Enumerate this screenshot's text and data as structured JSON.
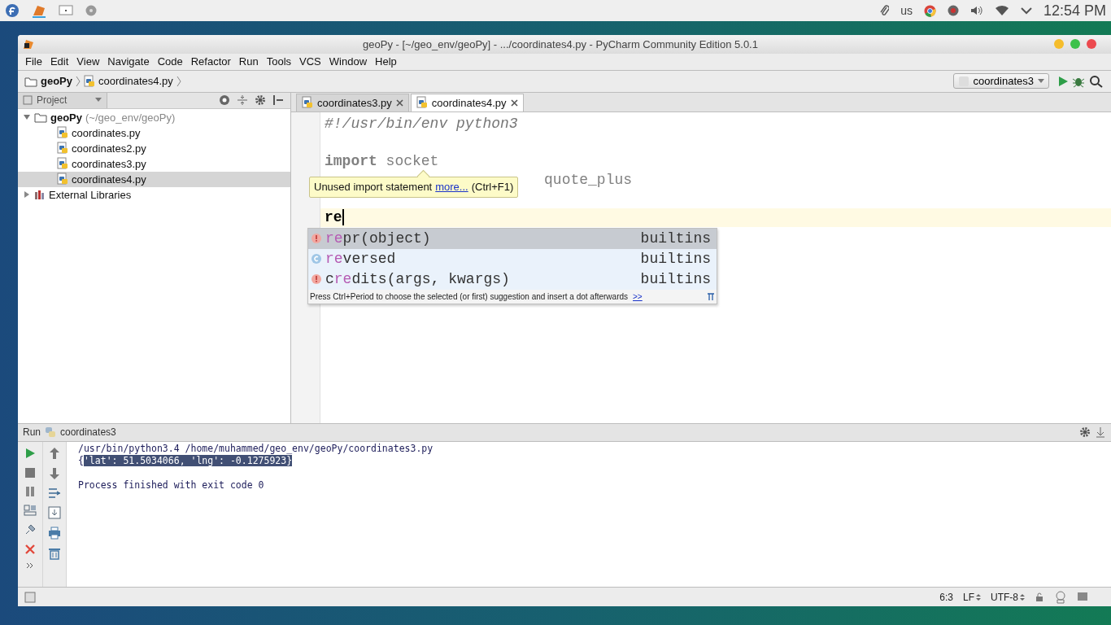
{
  "top_panel": {
    "keyboard_layout": "us",
    "clock": "12:54 PM"
  },
  "window": {
    "title": "geoPy - [~/geo_env/geoPy] - .../coordinates4.py - PyCharm Community Edition 5.0.1"
  },
  "menu": [
    "File",
    "Edit",
    "View",
    "Navigate",
    "Code",
    "Refactor",
    "Run",
    "Tools",
    "VCS",
    "Window",
    "Help"
  ],
  "breadcrumb": [
    "geoPy",
    "coordinates4.py"
  ],
  "run_config": {
    "label": "coordinates3"
  },
  "project_panel": {
    "title": "Project",
    "tree": [
      {
        "label": "geoPy",
        "path": "(~/geo_env/geoPy)",
        "kind": "folder",
        "expanded": true,
        "selected": false,
        "children": [
          {
            "label": "coordinates.py",
            "kind": "file",
            "selected": false
          },
          {
            "label": "coordinates2.py",
            "kind": "file",
            "selected": false
          },
          {
            "label": "coordinates3.py",
            "kind": "file",
            "selected": false
          },
          {
            "label": "coordinates4.py",
            "kind": "file",
            "selected": true
          }
        ]
      },
      {
        "label": "External Libraries",
        "kind": "library",
        "expanded": false,
        "selected": false
      }
    ]
  },
  "editor": {
    "tabs": [
      {
        "label": "coordinates3.py",
        "selected": false
      },
      {
        "label": "coordinates4.py",
        "selected": true
      }
    ],
    "lines": [
      {
        "kind": "comment",
        "text": "#!/usr/bin/env python3"
      },
      {
        "kind": "blank"
      },
      {
        "kind": "code",
        "text": "**import** socket"
      },
      {
        "kind": "covered",
        "text": "quote_plus"
      },
      {
        "kind": "blank"
      },
      {
        "kind": "current",
        "text": "re"
      }
    ],
    "tooltip": {
      "text": "Unused import statement",
      "link": "more...",
      "shortcut": "(Ctrl+F1)"
    },
    "completion": {
      "items": [
        {
          "kind": "function",
          "text": "**re**pr(object)",
          "source": "builtins",
          "selected": true
        },
        {
          "kind": "class",
          "text": "**re**versed",
          "source": "builtins",
          "selected": false
        },
        {
          "kind": "function",
          "text": "c**re**dits(args, kwargs)",
          "source": "builtins",
          "selected": false
        }
      ],
      "hint": "Press Ctrl+Period to choose the selected (or first) suggestion and insert a dot afterwards",
      "hint_link": ">>"
    }
  },
  "run_panel": {
    "title": "Run",
    "config": "coordinates3",
    "lines": [
      {
        "kind": "output",
        "text": "/usr/bin/python3.4 /home/muhammed/geo_env/geoPy/coordinates3.py"
      },
      {
        "kind": "output",
        "text": "{",
        "selected_text": "'lat': 51.5034066, 'lng': -0.1275923}"
      },
      {
        "kind": "blank"
      },
      {
        "kind": "output",
        "text": "Process finished with exit code 0"
      }
    ]
  },
  "status_bar": {
    "position": "6:3",
    "line_separator": "LF",
    "encoding": "UTF-8"
  }
}
